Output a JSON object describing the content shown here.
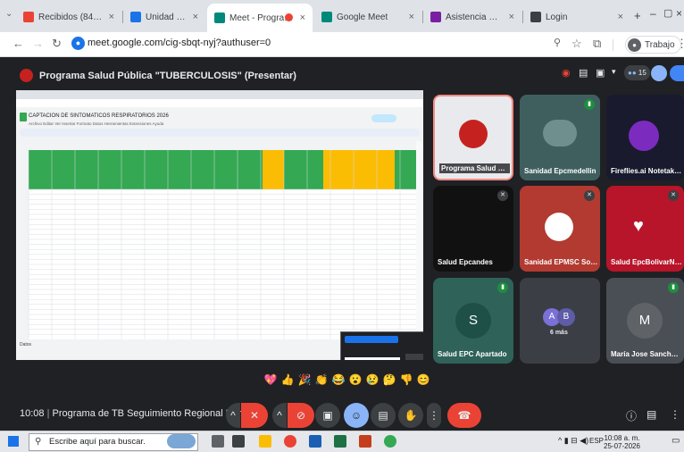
{
  "browser": {
    "tabs": [
      {
        "title": "Recibidos (84) - man",
        "active": false,
        "favicon_color": "#ea4335"
      },
      {
        "title": "Unidad de Servicios T",
        "active": false,
        "favicon_color": "#1a73e8"
      },
      {
        "title": "Meet - Programa",
        "active": true,
        "favicon_color": "#00897b"
      },
      {
        "title": "Google Meet",
        "active": false,
        "favicon_color": "#00897b"
      },
      {
        "title": "Asistencia mesa técn",
        "active": false,
        "favicon_color": "#7b1fa2"
      },
      {
        "title": "Login",
        "active": false,
        "favicon_color": "#3c4043"
      }
    ],
    "url": "meet.google.com/cig-sbqt-nyj?authuser=0",
    "profile_label": "Trabajo"
  },
  "meet": {
    "presentation_title": "Programa Salud Pública \"TUBERCULOSIS\" (Presentar)",
    "participant_count": "15",
    "meeting_name": "Programa de TB Seguimiento Regional Noroeste",
    "time": "10:08",
    "tiles": [
      {
        "name": "Programa Salud Pública ...",
        "bg": "#e8eaed",
        "mic": "none"
      },
      {
        "name": "Sanidad Epcmedellin",
        "bg": "#3f5f5f",
        "mic": "on"
      },
      {
        "name": "Fireflies.ai Notetaker Pr...",
        "bg": "#1a1a2e",
        "mic": "none"
      },
      {
        "name": "Salud Epcandes",
        "bg": "#111111",
        "mic": "off"
      },
      {
        "name": "Sanidad EPMSC Sonson",
        "bg": "#b23a30",
        "mic": "off"
      },
      {
        "name": "Salud EpcBolivarNoroeste",
        "bg": "#b8142a",
        "mic": "off"
      },
      {
        "name": "Salud EPC Apartado",
        "bg": "#2f6259",
        "mic": "on",
        "letter": "S"
      },
      {
        "name": "6 más",
        "bg": "#3b3e44",
        "mic": "none",
        "letters": [
          "A",
          "B"
        ]
      },
      {
        "name": "María Jose Sanchez Gu...",
        "bg": "#4a4f55",
        "mic": "on",
        "letter": "M"
      }
    ],
    "emojis": [
      "💖",
      "👍",
      "🎉",
      "👏",
      "😂",
      "😮",
      "😢",
      "🤔",
      "👎",
      "😊"
    ]
  },
  "spreadsheet": {
    "title": "CAPTACION DE SINTOMATICOS RESPIRATORIOS 2026",
    "menu": "Archivo  Editar  Ver  Insertar  Formato  Datos  Herramientas  Extensiones  Ayuda",
    "sheet_tab": "Datos"
  },
  "taskbar": {
    "search_placeholder": "Escribe aquí para buscar.",
    "time": "10:08 a. m.",
    "date": "25-07-2026",
    "lang": "ESP"
  },
  "colors": {
    "meet_bg": "#202124",
    "hangup": "#ea4335",
    "sheet_header_green": "#34a853",
    "sheet_header_yellow": "#fbbc04"
  }
}
